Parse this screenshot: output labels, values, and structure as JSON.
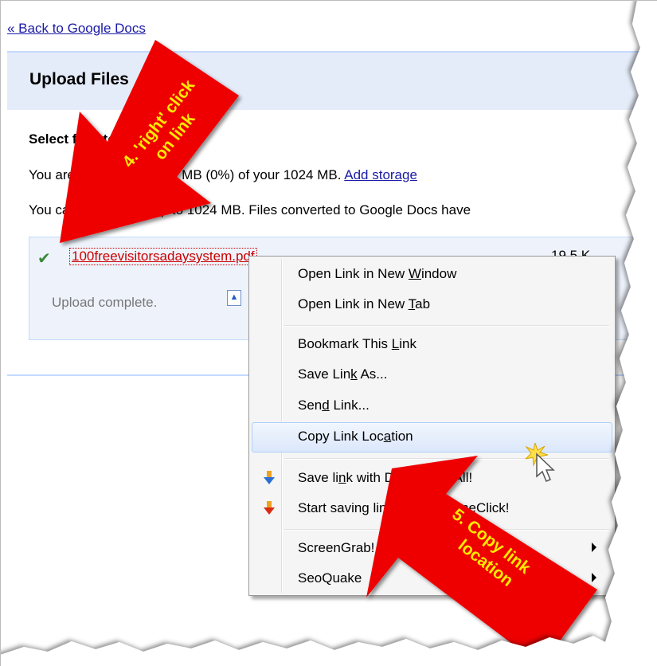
{
  "page": {
    "back_link": "« Back to Google Docs",
    "title": "Upload Files",
    "section_title": "Select files to upload",
    "usage_text_start": "You are currently using 0 MB (0%) of your 1024 MB.",
    "add_storage": "Add storage",
    "limit_text": "You can upload files up to 1024 MB. Files converted to Google Docs have",
    "file_name": "100freevisitorsadaysystem.pdf",
    "file_size": "19.5 K",
    "upload_status": "Upload complete."
  },
  "context_menu": {
    "items": [
      {
        "pre": "Open Link in New ",
        "u": "W",
        "post": "indow"
      },
      {
        "pre": "Open Link in New ",
        "u": "T",
        "post": "ab"
      },
      {
        "pre": "Bookmark This ",
        "u": "L",
        "post": "ink"
      },
      {
        "pre": "Save Lin",
        "u": "k",
        "post": " As..."
      },
      {
        "pre": "Sen",
        "u": "d",
        "post": " Link..."
      },
      {
        "pre": "Copy Link Loc",
        "u": "a",
        "post": "tion"
      },
      {
        "pre": "Save li",
        "u": "n",
        "post": "k with DownThemAll!"
      },
      {
        "pre": "Start saving link with dTa OneClick!",
        "u": "",
        "post": ""
      },
      {
        "pre": "ScreenGrab!",
        "u": "",
        "post": ""
      },
      {
        "pre": "SeoQuake",
        "u": "",
        "post": ""
      }
    ]
  },
  "annotations": {
    "step4_line1": "4. 'right' click",
    "step4_line2": "on link",
    "step5_line1": "5. Copy link",
    "step5_line2": "location"
  },
  "colors": {
    "arrow_red": "#ee0000",
    "annotation_text": "#ffea00",
    "header_bg": "#e5ecf9",
    "link_blue": "#1a1aa6",
    "file_link_red": "#cc0000"
  },
  "icons": [
    "check-icon",
    "upload-icon",
    "downthemall-icon",
    "dta-oneclick-icon",
    "submenu-arrow-icon",
    "cursor-icon",
    "sparkle-icon"
  ]
}
